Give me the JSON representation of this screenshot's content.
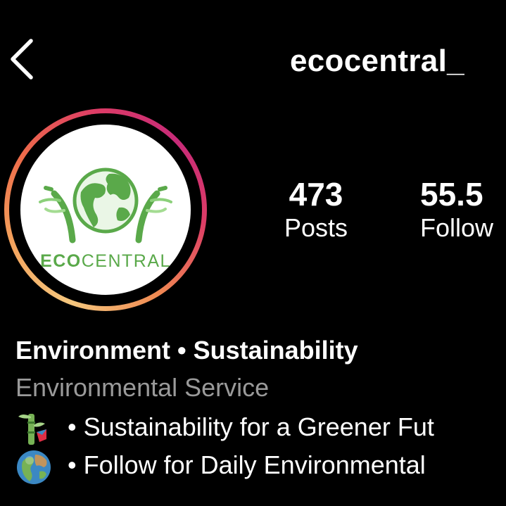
{
  "header": {
    "back_icon": "chevron-left-icon",
    "username": "ecocentral_"
  },
  "profile": {
    "logo_text_bold": "ECO",
    "logo_text_regular": "CENTRAL",
    "story_ring_colors": [
      "#f5c77e",
      "#ee6b4a",
      "#c72b79"
    ],
    "logo_color": "#5aa94a"
  },
  "stats": {
    "posts_count": "473",
    "posts_label": "Posts",
    "followers_count": "55.5",
    "followers_label": "Follow"
  },
  "bio": {
    "name": "Environment • Sustainability",
    "category": "Environmental Service",
    "lines": [
      {
        "icon": "bamboo-emoji-icon",
        "text": "• Sustainability for a Greener Fut"
      },
      {
        "icon": "globe-emoji-icon",
        "text": "• Follow for Daily Environmental"
      }
    ]
  }
}
